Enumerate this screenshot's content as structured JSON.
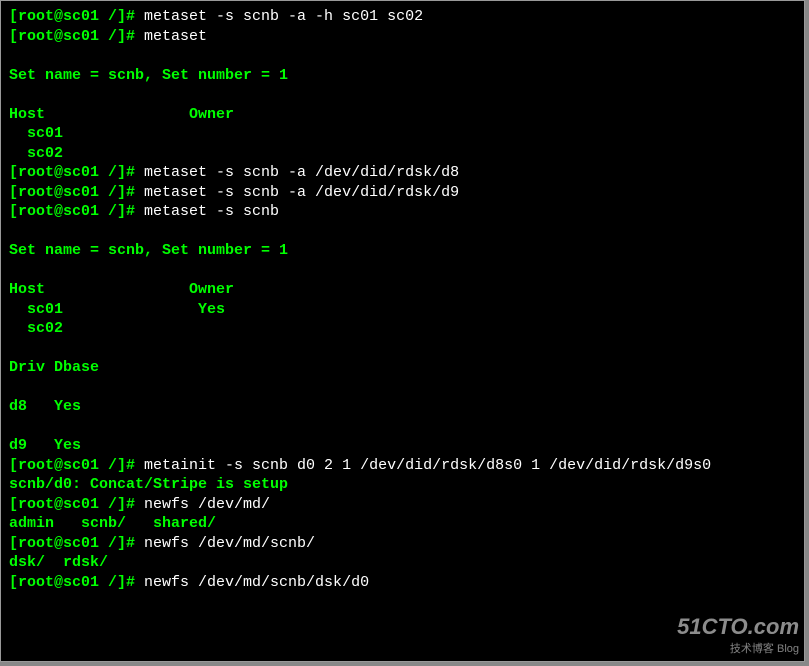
{
  "lines": [
    {
      "segments": [
        {
          "c": "prompt",
          "t": "[root@sc01 /]# "
        },
        {
          "c": "white",
          "t": "metaset -s scnb -a -h sc01 sc02"
        }
      ]
    },
    {
      "segments": [
        {
          "c": "prompt",
          "t": "[root@sc01 /]# "
        },
        {
          "c": "white",
          "t": "metaset"
        }
      ]
    },
    {
      "segments": [
        {
          "c": "prompt",
          "t": ""
        }
      ]
    },
    {
      "segments": [
        {
          "c": "prompt",
          "t": "Set name = scnb, Set number = 1"
        }
      ]
    },
    {
      "segments": [
        {
          "c": "prompt",
          "t": ""
        }
      ]
    },
    {
      "segments": [
        {
          "c": "prompt",
          "t": "Host                Owner"
        }
      ]
    },
    {
      "segments": [
        {
          "c": "prompt",
          "t": "  sc01"
        }
      ]
    },
    {
      "segments": [
        {
          "c": "prompt",
          "t": "  sc02"
        }
      ]
    },
    {
      "segments": [
        {
          "c": "prompt",
          "t": "[root@sc01 /]# "
        },
        {
          "c": "white",
          "t": "metaset -s scnb -a /dev/did/rdsk/d8"
        }
      ]
    },
    {
      "segments": [
        {
          "c": "prompt",
          "t": "[root@sc01 /]# "
        },
        {
          "c": "white",
          "t": "metaset -s scnb -a /dev/did/rdsk/d9"
        }
      ]
    },
    {
      "segments": [
        {
          "c": "prompt",
          "t": "[root@sc01 /]# "
        },
        {
          "c": "white",
          "t": "metaset -s scnb"
        }
      ]
    },
    {
      "segments": [
        {
          "c": "prompt",
          "t": ""
        }
      ]
    },
    {
      "segments": [
        {
          "c": "prompt",
          "t": "Set name = scnb, Set number = 1"
        }
      ]
    },
    {
      "segments": [
        {
          "c": "prompt",
          "t": ""
        }
      ]
    },
    {
      "segments": [
        {
          "c": "prompt",
          "t": "Host                Owner"
        }
      ]
    },
    {
      "segments": [
        {
          "c": "prompt",
          "t": "  sc01               Yes"
        }
      ]
    },
    {
      "segments": [
        {
          "c": "prompt",
          "t": "  sc02"
        }
      ]
    },
    {
      "segments": [
        {
          "c": "prompt",
          "t": ""
        }
      ]
    },
    {
      "segments": [
        {
          "c": "prompt",
          "t": "Driv Dbase"
        }
      ]
    },
    {
      "segments": [
        {
          "c": "prompt",
          "t": ""
        }
      ]
    },
    {
      "segments": [
        {
          "c": "prompt",
          "t": "d8   Yes"
        }
      ]
    },
    {
      "segments": [
        {
          "c": "prompt",
          "t": ""
        }
      ]
    },
    {
      "segments": [
        {
          "c": "prompt",
          "t": "d9   Yes"
        }
      ]
    },
    {
      "segments": [
        {
          "c": "prompt",
          "t": "[root@sc01 /]# "
        },
        {
          "c": "white",
          "t": "metainit -s scnb d0 2 1 /dev/did/rdsk/d8s0 1 /dev/did/rdsk/d9s0"
        }
      ]
    },
    {
      "segments": [
        {
          "c": "prompt",
          "t": "scnb/d0: Concat/Stripe is setup"
        }
      ]
    },
    {
      "segments": [
        {
          "c": "prompt",
          "t": "[root@sc01 /]# "
        },
        {
          "c": "white",
          "t": "newfs /dev/md/"
        }
      ]
    },
    {
      "segments": [
        {
          "c": "prompt",
          "t": "admin   scnb/   shared/"
        }
      ]
    },
    {
      "segments": [
        {
          "c": "prompt",
          "t": "[root@sc01 /]# "
        },
        {
          "c": "white",
          "t": "newfs /dev/md/scnb/"
        }
      ]
    },
    {
      "segments": [
        {
          "c": "prompt",
          "t": "dsk/  rdsk/"
        }
      ]
    },
    {
      "segments": [
        {
          "c": "prompt",
          "t": "[root@sc01 /]# "
        },
        {
          "c": "white",
          "t": "newfs /dev/md/scnb/dsk/d0"
        }
      ]
    }
  ],
  "watermark": {
    "title": "51CTO.com",
    "subtitle": "技术博客  Blog"
  }
}
